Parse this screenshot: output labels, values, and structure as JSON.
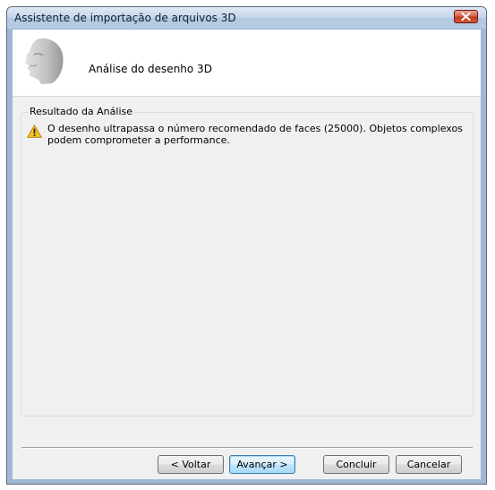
{
  "window": {
    "title": "Assistente de importação de arquivos 3D",
    "close_icon": "close-icon"
  },
  "header": {
    "title": "Análise do desenho 3D",
    "image_icon": "face-mesh-icon"
  },
  "analysis": {
    "group_label": "Resultado da Análise",
    "warning_icon": "warning-icon",
    "message": "O desenho ultrapassa o número recomendado de faces (25000). Objetos complexos podem comprometer a performance."
  },
  "buttons": {
    "back": "< Voltar",
    "next": "Avançar >",
    "finish": "Concluir",
    "cancel": "Cancelar"
  },
  "colors": {
    "titlebar": "#c5d6ea",
    "close_button": "#c9452a",
    "warning": "#f5c31d",
    "dialog_background": "#f0f0f0"
  }
}
